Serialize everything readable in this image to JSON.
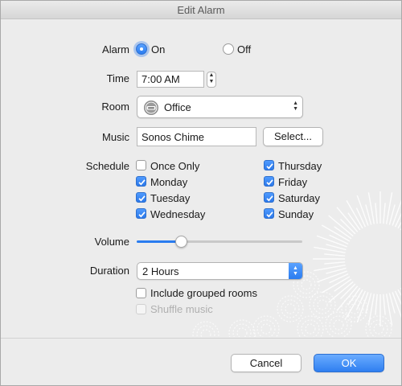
{
  "window": {
    "title": "Edit Alarm"
  },
  "alarm": {
    "label": "Alarm",
    "on_label": "On",
    "off_label": "Off",
    "selected": "On"
  },
  "time": {
    "label": "Time",
    "value": "7:00 AM"
  },
  "room": {
    "label": "Room",
    "value": "Office",
    "icon": "sonos-speaker-icon"
  },
  "music": {
    "label": "Music",
    "value": "Sonos Chime",
    "select_label": "Select..."
  },
  "schedule": {
    "label": "Schedule",
    "days": [
      {
        "label": "Once Only",
        "checked": false
      },
      {
        "label": "Monday",
        "checked": true
      },
      {
        "label": "Tuesday",
        "checked": true
      },
      {
        "label": "Wednesday",
        "checked": true
      },
      {
        "label": "Thursday",
        "checked": true
      },
      {
        "label": "Friday",
        "checked": true
      },
      {
        "label": "Saturday",
        "checked": true
      },
      {
        "label": "Sunday",
        "checked": true
      }
    ]
  },
  "volume": {
    "label": "Volume",
    "level_fraction": 0.27
  },
  "duration": {
    "label": "Duration",
    "value": "2 Hours"
  },
  "options": {
    "include_grouped_label": "Include grouped rooms",
    "include_grouped_checked": false,
    "shuffle_label": "Shuffle music",
    "shuffle_checked": false,
    "shuffle_enabled": false
  },
  "buttons": {
    "cancel_label": "Cancel",
    "ok_label": "OK"
  },
  "colors": {
    "accent": "#2a7cf0",
    "window_bg": "#ececec"
  }
}
